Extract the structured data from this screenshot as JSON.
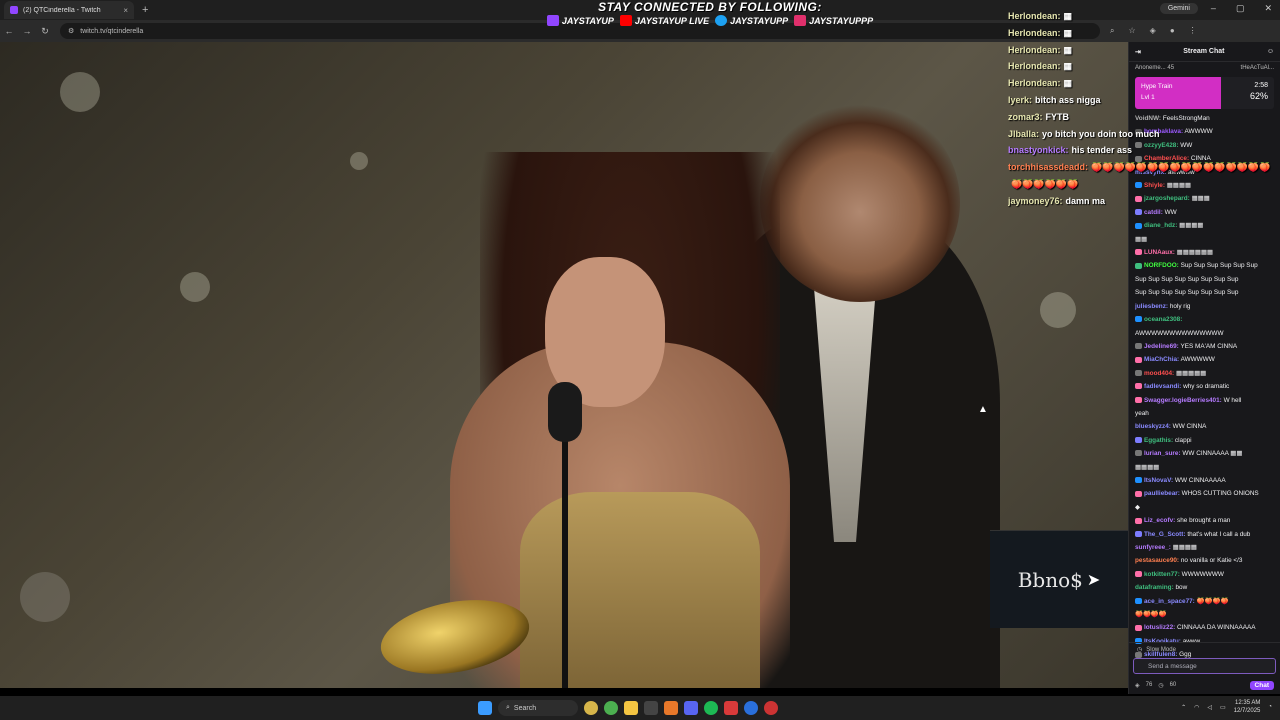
{
  "browser": {
    "tab_title": "(2) QTCinderella - Twitch",
    "url": "twitch.tv/qtcinderella",
    "gemini_label": "Gemini",
    "new_tab": "+",
    "close_tab": "×",
    "minimize": "–",
    "maximize": "▢",
    "close": "✕"
  },
  "banner": {
    "title": "STAY CONNECTED BY FOLLOWING:",
    "socials": [
      {
        "name": "twitch-icon",
        "handle": "JAYSTAYUP",
        "color": "#9146ff"
      },
      {
        "name": "youtube-icon",
        "handle": "JAYSTAYUP LIVE",
        "color": "#ff0000"
      },
      {
        "name": "twitter-icon",
        "handle": "JAYSTAYUPP",
        "color": "#1da1f2"
      },
      {
        "name": "instagram-icon",
        "handle": "JAYSTAYUPPP",
        "color": "#e1306c"
      }
    ]
  },
  "video": {
    "watermark": "Bbno$"
  },
  "overlay_chat": [
    {
      "user": "Herlondean:",
      "msg": "▦",
      "color": "#e6e6b0"
    },
    {
      "user": "Herlondean:",
      "msg": "▦",
      "color": "#e6e6b0"
    },
    {
      "user": "Herlondean:",
      "msg": "▦",
      "color": "#e6e6b0"
    },
    {
      "user": "Herlondean:",
      "msg": "▦",
      "color": "#e6e6b0"
    },
    {
      "user": "Herlondean:",
      "msg": "▦",
      "color": "#e6e6b0"
    },
    {
      "user": "lyerk:",
      "msg": "bitch ass nigga",
      "color": "#e6e6b0"
    },
    {
      "user": "zomar3:",
      "msg": "FYTB",
      "color": "#e6e6b0"
    },
    {
      "user": "Jlballa:",
      "msg": "yo bitch you doin too much",
      "color": "#e6e6b0"
    },
    {
      "user": "bnastyonkick:",
      "msg": "his tender ass",
      "color": "#b57bff"
    },
    {
      "user": "torchhisassdeadd:",
      "msg": "🍑🍑🍑🍑🍑🍑🍑🍑🍑🍑🍑🍑🍑🍑🍑🍑",
      "color": "#ff7f50"
    },
    {
      "user": "",
      "msg": "🍑🍑🍑🍑🍑🍑",
      "color": "#ff7f50"
    },
    {
      "user": "jaymoney76:",
      "msg": "damn ma",
      "color": "#e6e6b0"
    }
  ],
  "chat": {
    "header": "Stream Chat",
    "leader_left": "Anoneme... 45",
    "leader_right": "tHeAcTuAl...",
    "hype_title": "Hype Train",
    "hype_level": "Lvl 1",
    "hype_time": "2:58",
    "hype_pct": "62%",
    "messages": [
      {
        "user": "VoidNW:",
        "text": "FeelsStrongMan",
        "color": "#b0b0b0",
        "badge": ""
      },
      {
        "user": "bombaklava:",
        "text": "AWWWW",
        "color": "#9b59ff",
        "badge": "#555"
      },
      {
        "user": "ozzyyE428:",
        "text": "WW",
        "color": "#3fbf7f",
        "badge": "#777"
      },
      {
        "user": "ChamberAlice:",
        "text": "CINNA",
        "color": "#ff4f4f",
        "badge": "#777"
      },
      {
        "user": "missvynx:",
        "text": "awwwww",
        "color": "#8a8aff",
        "badge": ""
      },
      {
        "user": "Shiyle:",
        "text": "▦▦▦▦",
        "color": "#ff4f4f",
        "badge": "#1e90ff"
      },
      {
        "user": "jzargoshepard:",
        "text": "▦▦▦",
        "color": "#3fbf7f",
        "badge": "#ff6fa9"
      },
      {
        "user": "catdil:",
        "text": "WW",
        "color": "#b57bff",
        "badge": "#7d7dff"
      },
      {
        "user": "diane_hdz:",
        "text": "▦▦▦▦",
        "color": "#3fbf7f",
        "badge": "#1e90ff"
      },
      {
        "user": "",
        "text": "▦▦",
        "color": "#efeff1",
        "badge": ""
      },
      {
        "user": "LUNAaux:",
        "text": "▦▦▦▦▦▦",
        "color": "#ff6fa9",
        "badge": "#ff6fa9"
      },
      {
        "user": "NORFDOO:",
        "text": "Sup Sup Sup Sup Sup Sup",
        "color": "#3fff3f",
        "badge": "#3fbf7f"
      },
      {
        "user": "",
        "text": "Sup Sup Sup Sup Sup Sup Sup Sup",
        "color": "#efeff1",
        "badge": ""
      },
      {
        "user": "",
        "text": "Sup Sup Sup Sup Sup Sup Sup Sup",
        "color": "#efeff1",
        "badge": ""
      },
      {
        "user": "juliesbenz:",
        "text": "holy rig",
        "color": "#8a8aff",
        "badge": ""
      },
      {
        "user": "oceana2308:",
        "text": "",
        "color": "#3fbf7f",
        "badge": "#1e90ff"
      },
      {
        "user": "",
        "text": "AWWWWWWWWWWWWWW",
        "color": "#efeff1",
        "badge": ""
      },
      {
        "user": "Jedeline69:",
        "text": "YES MA'AM CINNA",
        "color": "#b57bff",
        "badge": "#777"
      },
      {
        "user": "MiaChChia:",
        "text": "AWWWWW",
        "color": "#8a8aff",
        "badge": "#ff6fa9"
      },
      {
        "user": "mood404:",
        "text": "▦▦▦▦▦",
        "color": "#ff4f4f",
        "badge": "#777"
      },
      {
        "user": "fadlevsandi:",
        "text": "why so dramatic",
        "color": "#8a8aff",
        "badge": "#ff6fa9"
      },
      {
        "user": "Swagger.logieBerries401:",
        "text": "W hell",
        "color": "#b57bff",
        "badge": "#ff6fa9"
      },
      {
        "user": "",
        "text": "yeah",
        "color": "#efeff1",
        "badge": ""
      },
      {
        "user": "blueskyzz4:",
        "text": "WW CINNA",
        "color": "#8a8aff",
        "badge": ""
      },
      {
        "user": "Eggathis:",
        "text": "clappi",
        "color": "#3fbf7f",
        "badge": "#7d7dff"
      },
      {
        "user": "lurian_sure:",
        "text": "WW CINNAAAA ▦▦",
        "color": "#b57bff",
        "badge": "#777"
      },
      {
        "user": "",
        "text": "▦▦▦▦",
        "color": "#efeff1",
        "badge": ""
      },
      {
        "user": "ItsNovaV:",
        "text": "WW CINNAAAAA",
        "color": "#8a8aff",
        "badge": "#1e90ff"
      },
      {
        "user": "paulliebear:",
        "text": "WHOS CUTTING ONIONS",
        "color": "#8a8aff",
        "badge": "#ff6fa9"
      },
      {
        "user": "",
        "text": "◆",
        "color": "#efeff1",
        "badge": ""
      },
      {
        "user": "Liz_ecofv:",
        "text": "she brought a man",
        "color": "#b57bff",
        "badge": "#ff6fa9"
      },
      {
        "user": "The_G_Scott:",
        "text": "that's what I call a dub",
        "color": "#8a8aff",
        "badge": "#7d7dff"
      },
      {
        "user": "sunfyreee_:",
        "text": "▦▦▦▦",
        "color": "#b57bff",
        "badge": ""
      },
      {
        "user": "pestasauce90:",
        "text": "no vanilla or Katie </3",
        "color": "#ff7f50",
        "badge": ""
      },
      {
        "user": "kotkitten77:",
        "text": "WWWWWWW",
        "color": "#3fbf7f",
        "badge": "#ff6fa9"
      },
      {
        "user": "dataframing:",
        "text": "bow",
        "color": "#3fbf7f",
        "badge": ""
      },
      {
        "user": "ace_in_space77:",
        "text": "🍑🍑🍑🍑",
        "color": "#8a8aff",
        "badge": "#1e90ff"
      },
      {
        "user": "",
        "text": "🍑🍑🍑🍑",
        "color": "#efeff1",
        "badge": ""
      },
      {
        "user": "lotusliz22:",
        "text": "CINNAAA DA WINNAAAAA",
        "color": "#b57bff",
        "badge": "#ff6fa9"
      },
      {
        "user": "ItsKooikatu:",
        "text": "awww",
        "color": "#8a8aff",
        "badge": "#1e90ff"
      },
      {
        "user": "skillfulen8:",
        "text": "Ggg",
        "color": "#8a8aff",
        "badge": "#777"
      }
    ],
    "slow_mode": "Slow Mode",
    "input_placeholder": "Send a message",
    "footer_points": "76",
    "footer_count": "60",
    "chat_button": "Chat"
  },
  "taskbar": {
    "search": "Search",
    "time": "12:35 AM",
    "date": "12/7/2025"
  }
}
